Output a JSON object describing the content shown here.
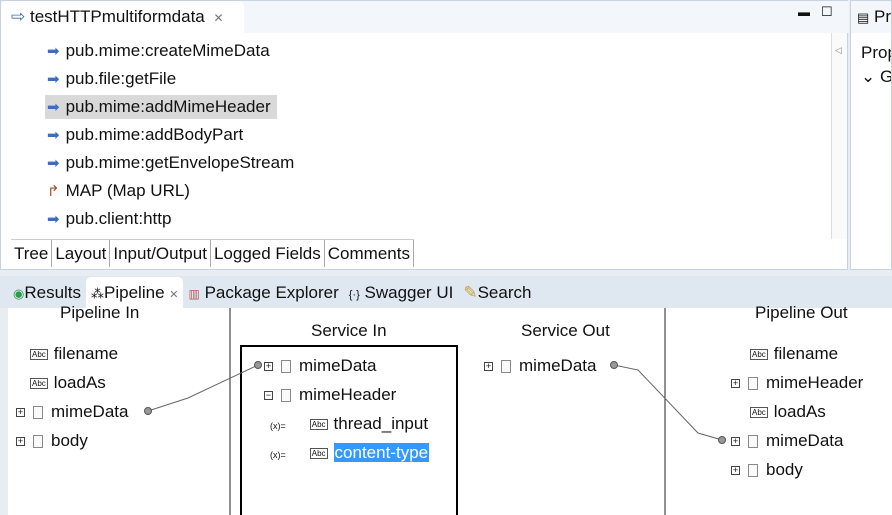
{
  "editor": {
    "title": "testHTTPmultiformdata",
    "steps": [
      {
        "label": "pub.mime:createMimeData",
        "icon": "invoke-arrow-icon"
      },
      {
        "label": "pub.file:getFile",
        "icon": "invoke-arrow-icon"
      },
      {
        "label": "pub.mime:addMimeHeader",
        "icon": "invoke-arrow-icon",
        "selected": true
      },
      {
        "label": "pub.mime:addBodyPart",
        "icon": "invoke-arrow-icon"
      },
      {
        "label": "pub.mime:getEnvelopeStream",
        "icon": "invoke-arrow-icon"
      },
      {
        "label": "MAP (Map URL)",
        "icon": "map-icon"
      },
      {
        "label": "pub.client:http",
        "icon": "invoke-arrow-icon"
      }
    ],
    "bottom_tabs": [
      "Tree",
      "Layout",
      "Input/Output",
      "Logged Fields",
      "Comments"
    ]
  },
  "right_panel": {
    "tab": "Pr",
    "label": "Prop",
    "section": "Ge"
  },
  "views": {
    "tabs": [
      "Results",
      "Pipeline",
      "Package Explorer",
      "Swagger UI",
      "Search"
    ]
  },
  "pipeline": {
    "headers": {
      "pipeline_in": "Pipeline In",
      "service_in": "Service In",
      "service_out": "Service Out",
      "pipeline_out": "Pipeline Out"
    },
    "pipeline_in": [
      "filename",
      "loadAs",
      "mimeData",
      "body"
    ],
    "service_in": [
      "mimeData",
      "mimeHeader",
      "thread_input",
      "content-type"
    ],
    "service_out": [
      "mimeData"
    ],
    "pipeline_out": [
      "filename",
      "mimeHeader",
      "loadAs",
      "mimeData",
      "body"
    ]
  }
}
